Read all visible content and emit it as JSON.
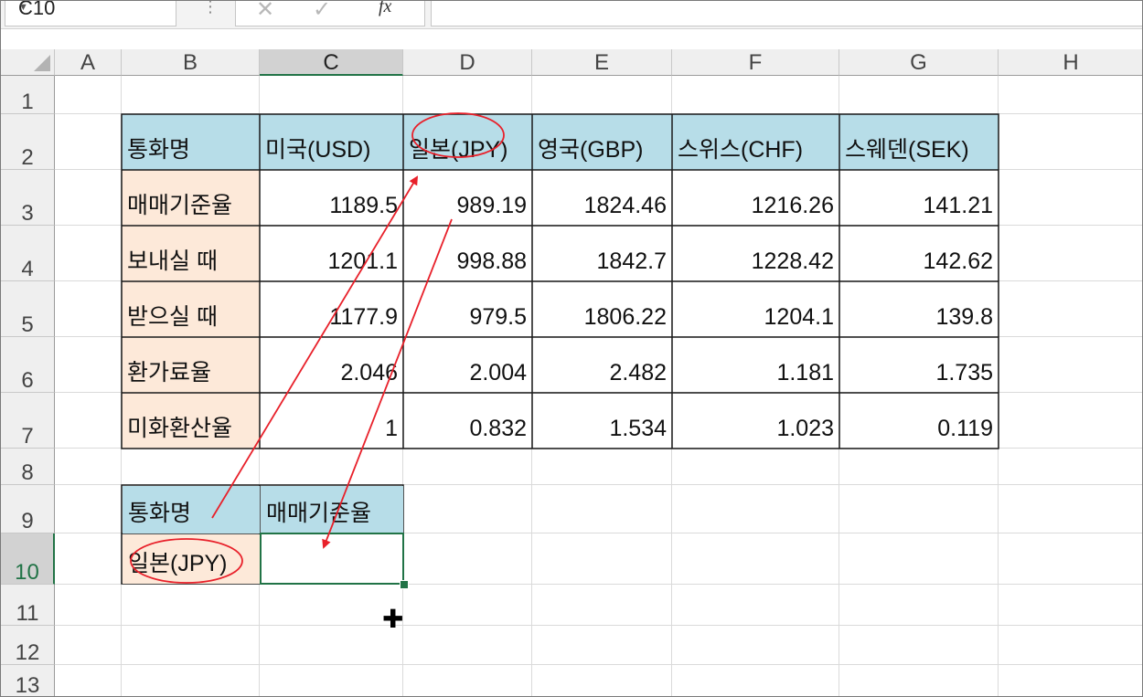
{
  "formula_bar": {
    "name_box": "C10",
    "cancel_icon": "✕",
    "enter_icon": "✓",
    "fx_label": "fx",
    "formula": ""
  },
  "columns": [
    "A",
    "B",
    "C",
    "D",
    "E",
    "F",
    "G",
    "H"
  ],
  "selected_column": "C",
  "rows": [
    "1",
    "2",
    "3",
    "4",
    "5",
    "6",
    "7",
    "8",
    "9",
    "10",
    "11",
    "12",
    "13"
  ],
  "selected_row": "10",
  "table": {
    "header": [
      "통화명",
      "미국(USD)",
      "일본(JPY)",
      "영국(GBP)",
      "스위스(CHF)",
      "스웨덴(SEK)"
    ],
    "rows": [
      [
        "매매기준율",
        "1189.5",
        "989.19",
        "1824.46",
        "1216.26",
        "141.21"
      ],
      [
        "보내실 때",
        "1201.1",
        "998.88",
        "1842.7",
        "1228.42",
        "142.62"
      ],
      [
        "받으실 때",
        "1177.9",
        "979.5",
        "1806.22",
        "1204.1",
        "139.8"
      ],
      [
        "환가료율",
        "2.046",
        "2.004",
        "2.482",
        "1.181",
        "1.735"
      ],
      [
        "미화환산율",
        "1",
        "0.832",
        "1.534",
        "1.023",
        "0.119"
      ]
    ]
  },
  "lookup": {
    "header": [
      "통화명",
      "매매기준율"
    ],
    "values": [
      "일본(JPY)",
      ""
    ]
  },
  "colors": {
    "header_fill": "#b7dde8",
    "label_fill": "#fde9d9",
    "selection": "#217346",
    "annotation": "#e8202a"
  }
}
